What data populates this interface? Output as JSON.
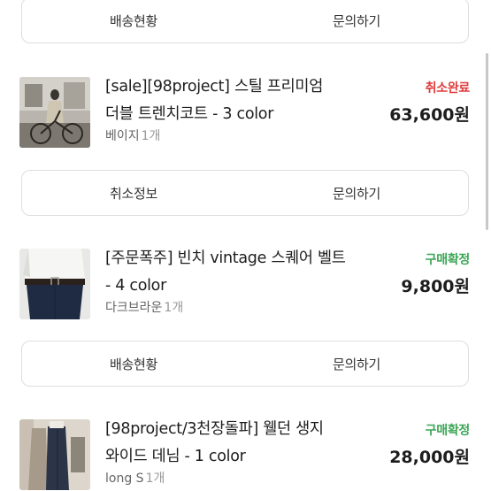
{
  "rows": [
    {
      "left": "배송현황",
      "right": "문의하기"
    },
    {
      "left": "취소정보",
      "right": "문의하기"
    },
    {
      "left": "배송현황",
      "right": "문의하기"
    }
  ],
  "orders": [
    {
      "title_line1": "[sale][98project] 스틸 프리미엄",
      "title_line2": "더블 트렌치코트 - 3 color",
      "option": "베이지",
      "qty": "1개",
      "status": "취소완료",
      "status_color": "#e03b3b",
      "price": "63,600원"
    },
    {
      "title_line1": "[주문폭주] 빈치 vintage 스퀘어 벨트",
      "title_line2": "- 4 color",
      "option": "다크브라운",
      "qty": "1개",
      "status": "구매확정",
      "status_color": "#3aa655",
      "price": "9,800원"
    },
    {
      "title_line1": "[98project/3천장돌파] 웰던 생지",
      "title_line2": "와이드 데님 - 1 color",
      "option": "long S",
      "qty": "1개",
      "status": "구매확정",
      "status_color": "#3aa655",
      "price": "28,000원"
    }
  ]
}
